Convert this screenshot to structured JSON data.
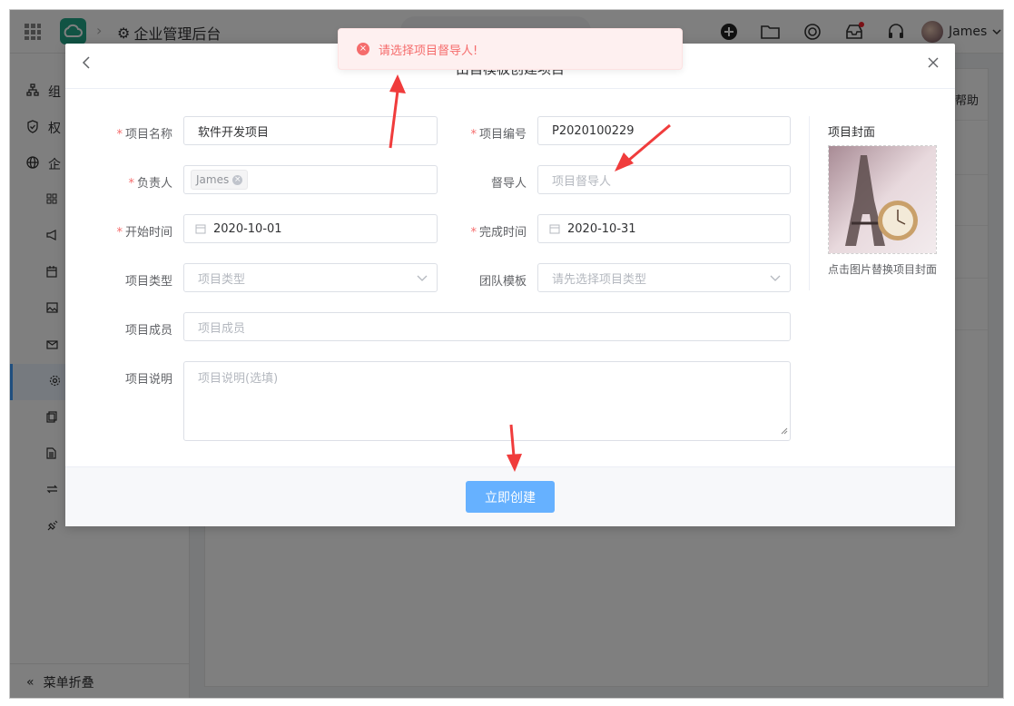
{
  "app": {
    "title": "企业管理后台",
    "user_name": "James"
  },
  "sidebar": {
    "items": [
      {
        "label": "组",
        "icon": "org-chart-icon"
      },
      {
        "label": "权",
        "icon": "shield-icon"
      },
      {
        "label": "企",
        "icon": "globe-icon"
      }
    ],
    "collapse_label": "菜单折叠"
  },
  "main": {
    "help_label": "帮助"
  },
  "toast": {
    "message": "请选择项目督导人!",
    "color": "#f56c6c"
  },
  "dialog": {
    "title": "由自模板创建项目",
    "form": {
      "name": {
        "label": "项目名称",
        "value": "软件开发项目",
        "required": true
      },
      "code": {
        "label": "项目编号",
        "value": "P2020100229",
        "required": true
      },
      "owner": {
        "label": "负责人",
        "tag": "James",
        "required": true
      },
      "supervisor": {
        "label": "督导人",
        "placeholder": "项目督导人",
        "required": false
      },
      "start": {
        "label": "开始时间",
        "value": "2020-10-01",
        "required": true
      },
      "end": {
        "label": "完成时间",
        "value": "2020-10-31",
        "required": true
      },
      "type": {
        "label": "项目类型",
        "placeholder": "项目类型"
      },
      "team": {
        "label": "团队模板",
        "placeholder": "请先选择项目类型"
      },
      "members": {
        "label": "项目成员",
        "placeholder": "项目成员"
      },
      "desc": {
        "label": "项目说明",
        "placeholder": "项目说明(选填)"
      }
    },
    "cover": {
      "title": "项目封面",
      "hint": "点击图片替换项目封面"
    },
    "submit_label": "立即创建",
    "accent_color": "#66b1ff"
  }
}
